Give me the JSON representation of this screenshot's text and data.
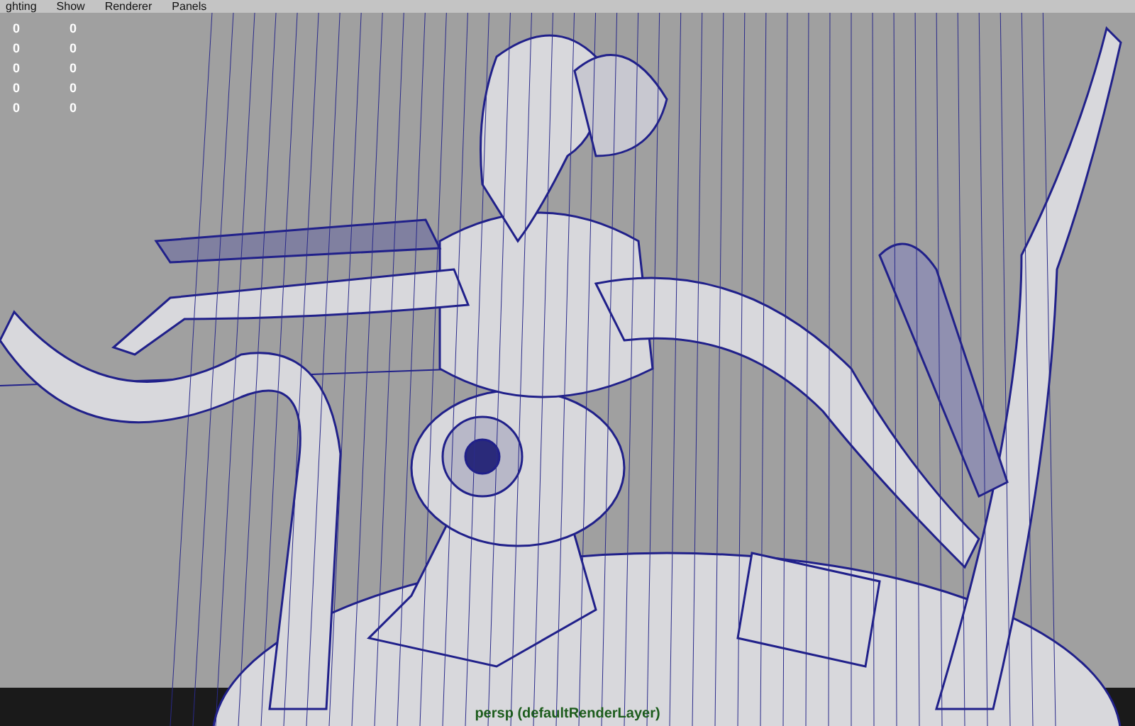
{
  "menu_bar": {
    "items": [
      "ghting",
      "Show",
      "Renderer",
      "Panels"
    ]
  },
  "hud_stats": {
    "rows": [
      [
        "0",
        "0"
      ],
      [
        "0",
        "0"
      ],
      [
        "0",
        "0"
      ],
      [
        "0",
        "0"
      ],
      [
        "0",
        "0"
      ]
    ]
  },
  "viewport": {
    "camera_label": "persp (defaultRenderLayer)"
  }
}
